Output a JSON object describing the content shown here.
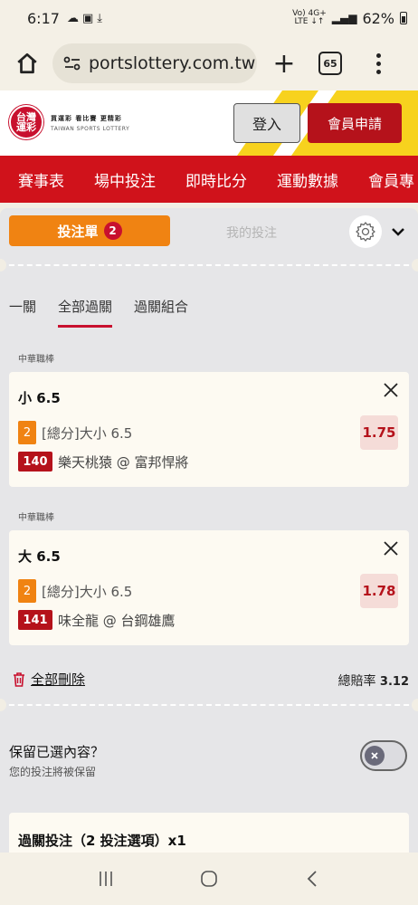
{
  "status_bar": {
    "time": "6:17",
    "network_top": "Vo) 4G+",
    "network_bottom": "LTE ↓↑",
    "battery": "62%"
  },
  "browser": {
    "url": "portslottery.com.tw",
    "tab_count": "65"
  },
  "header": {
    "logo_line1": "台灣",
    "logo_line2": "運彩",
    "logo_tagline": "買運彩 看比賽 更精彩",
    "logo_english": "TAIWAN SPORTS LOTTERY",
    "login_label": "登入",
    "register_label": "會員申請"
  },
  "nav": {
    "items": [
      "賽事表",
      "場中投注",
      "即時比分",
      "運動數據",
      "會員專"
    ]
  },
  "bet_slip": {
    "slip_tab_label": "投注單",
    "slip_count": "2",
    "my_bets_label": "我的投注",
    "sub_tabs": [
      "一關",
      "全部過關",
      "過關組合"
    ],
    "selections": [
      {
        "league": "中華職棒",
        "selection": "小 6.5",
        "market_badge": "2",
        "market": "[總分]大小 6.5",
        "game_no": "140",
        "teams": "樂天桃猿 @ 富邦悍將",
        "odds": "1.75"
      },
      {
        "league": "中華職棒",
        "selection": "大 6.5",
        "market_badge": "2",
        "market": "[總分]大小 6.5",
        "game_no": "141",
        "teams": "味全龍 @ 台鋼雄鷹",
        "odds": "1.78"
      }
    ],
    "delete_all_label": "全部刪除",
    "total_odds_label": "總賠率",
    "total_odds_value": "3.12",
    "keep_title": "保留已選內容？",
    "keep_subtitle": "您的投注將被保留",
    "parlay_title": "過關投注（2 投注選項）x1"
  },
  "colors": {
    "brand_red": "#d0121b",
    "accent_orange": "#f08312",
    "yellow": "#f7d21e"
  }
}
